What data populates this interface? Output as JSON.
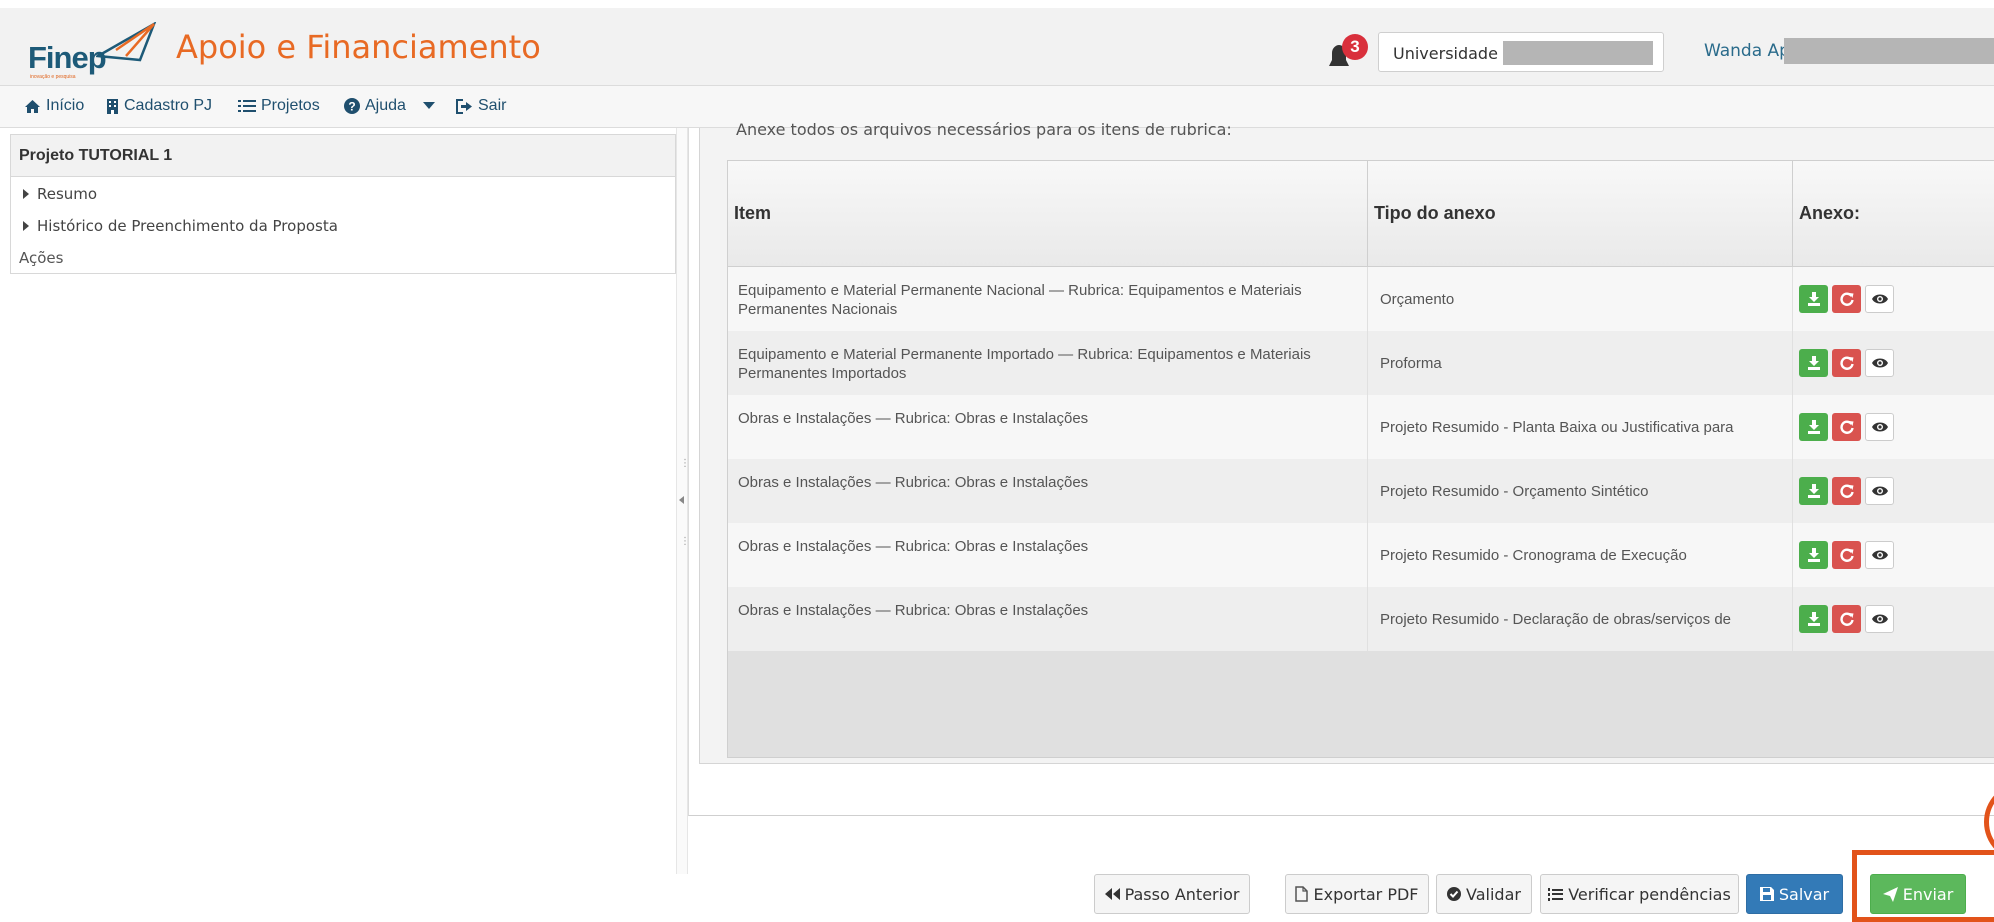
{
  "header": {
    "logo_text": "Finep",
    "logo_tagline": "inovação e pesquisa",
    "app_title": "Apoio e Financiamento",
    "notification_count": "3",
    "organization": "Universidade c",
    "user_name": "Wanda Ap"
  },
  "nav": [
    {
      "label": "Início",
      "icon": "home-icon"
    },
    {
      "label": "Cadastro PJ",
      "icon": "building-icon"
    },
    {
      "label": "Projetos",
      "icon": "list-icon"
    },
    {
      "label": "Ajuda",
      "icon": "question-circle-icon"
    },
    {
      "label": "Sair",
      "icon": "sign-out-icon"
    }
  ],
  "left_panel": {
    "project_title": "Projeto TUTORIAL 1",
    "items": [
      "Resumo",
      "Histórico de Preenchimento da Proposta"
    ],
    "actions_label": "Ações"
  },
  "main": {
    "instruction": "Anexe todos os arquivos necessários para os itens de rubrica:",
    "columns": [
      "Item",
      "Tipo do anexo",
      "Anexo:"
    ],
    "rows": [
      {
        "item": "Equipamento e Material Permanente Nacional — Rubrica: Equipamentos e Materiais Permanentes Nacionais",
        "tipo": "Orçamento"
      },
      {
        "item": "Equipamento e Material Permanente Importado — Rubrica: Equipamentos e Materiais Permanentes Importados",
        "tipo": "Proforma"
      },
      {
        "item": "Obras e Instalações — Rubrica: Obras e Instalações",
        "tipo": "Projeto Resumido - Planta Baixa ou Justificativa para"
      },
      {
        "item": "Obras e Instalações — Rubrica: Obras e Instalações",
        "tipo": "Projeto Resumido - Orçamento Sintético"
      },
      {
        "item": "Obras e Instalações — Rubrica: Obras e Instalações",
        "tipo": "Projeto Resumido - Cronograma de Execução"
      },
      {
        "item": "Obras e Instalações — Rubrica: Obras e Instalações",
        "tipo": "Projeto Resumido - Declaração de obras/serviços de"
      }
    ]
  },
  "footer": {
    "prev_label": "Passo Anterior",
    "export_label": "Exportar PDF",
    "validate_label": "Validar",
    "pending_label": "Verificar pendências",
    "save_label": "Salvar",
    "send_label": "Enviar"
  },
  "colors": {
    "brand_orange": "#e86a24",
    "brand_blue": "#1d5a78",
    "success": "#5cb85c",
    "danger": "#d9534f",
    "primary": "#337ab7",
    "highlight": "#e2531a"
  }
}
